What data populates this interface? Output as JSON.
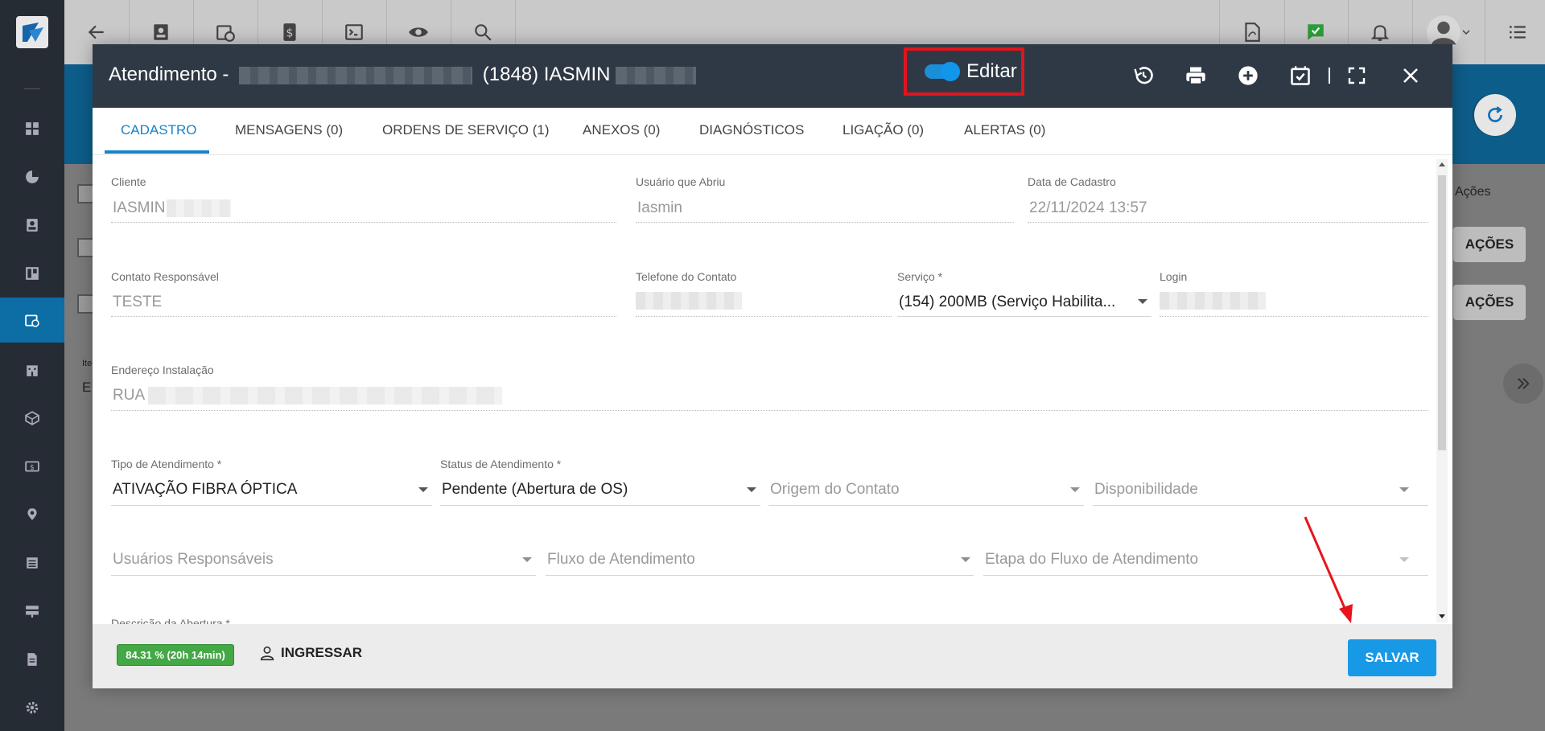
{
  "topbar": {
    "icons": [
      "back-arrow-icon",
      "contact-card-icon",
      "calendar-clock-icon",
      "dollar-icon",
      "terminal-icon",
      "eye-icon",
      "search-icon",
      "pdf-icon",
      "chat-check-icon",
      "bell-icon",
      "avatar",
      "list-menu-icon"
    ]
  },
  "background": {
    "actions_header": "Ações",
    "actions_button_1": "AÇÕES",
    "actions_button_2": "AÇÕES",
    "partial_label_1": "Ite",
    "partial_label_2": "E"
  },
  "modal": {
    "title_prefix": "Atendimento -",
    "title_middle": "(1848) IASMIN",
    "edit_toggle_label": "Editar",
    "edit_toggle_on": true,
    "tabs": [
      {
        "label": "CADASTRO"
      },
      {
        "label": "MENSAGENS (0)"
      },
      {
        "label": "ORDENS DE SERVIÇO (1)"
      },
      {
        "label": "ANEXOS (0)"
      },
      {
        "label": "DIAGNÓSTICOS"
      },
      {
        "label": "LIGAÇÃO (0)"
      },
      {
        "label": "ALERTAS (0)"
      }
    ],
    "form": {
      "cliente_label": "Cliente",
      "cliente_value": "IASMIN",
      "usuario_label": "Usuário que Abriu",
      "usuario_value": "Iasmin",
      "data_label": "Data de Cadastro",
      "data_value": "22/11/2024 13:57",
      "contato_label": "Contato Responsável",
      "contato_value": "TESTE",
      "telefone_label": "Telefone do Contato",
      "servico_label": "Serviço",
      "servico_value": "(154) 200MB (Serviço Habilita...",
      "login_label": "Login",
      "endereco_label": "Endereço Instalação",
      "endereco_value": "RUA",
      "tipo_label": "Tipo de Atendimento",
      "tipo_value": "ATIVAÇÃO FIBRA ÓPTICA",
      "status_label": "Status de Atendimento",
      "status_value": "Pendente (Abertura de OS)",
      "origem_placeholder": "Origem do Contato",
      "disponibilidade_placeholder": "Disponibilidade",
      "usuarios_placeholder": "Usuários Responsáveis",
      "fluxo_placeholder": "Fluxo de Atendimento",
      "etapa_placeholder": "Etapa do Fluxo de Atendimento",
      "descricao_label": "Descrição da Abertura",
      "required_mark": "*"
    },
    "footer": {
      "progress_text": "84.31 % (20h 14min)",
      "join_label": "INGRESSAR",
      "save_label": "SALVAR"
    }
  },
  "colors": {
    "accent": "#1783c8",
    "save": "#1799e6",
    "progress": "#43a845",
    "highlight": "#e0151d",
    "header": "#2f3945"
  }
}
